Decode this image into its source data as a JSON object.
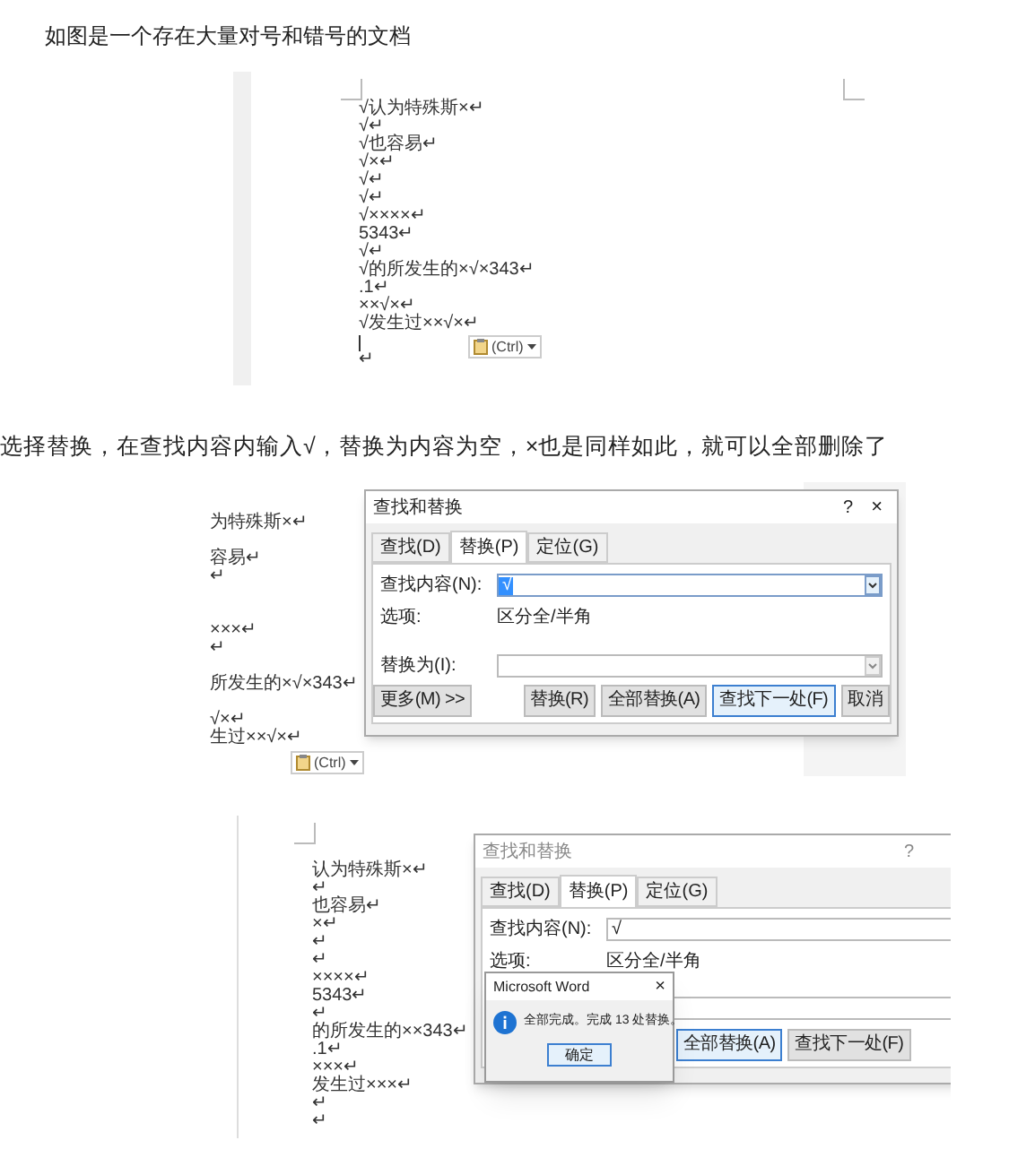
{
  "intro": "如图是一个存在大量对号和错号的文档",
  "figure_1": {
    "lines": [
      {
        "kind": "text",
        "text": "√认为特殊斯×↵"
      },
      {
        "kind": "text",
        "text": "√↵"
      },
      {
        "kind": "text",
        "text": "√也容易↵"
      },
      {
        "kind": "text",
        "text": "√×↵"
      },
      {
        "kind": "text",
        "text": "√↵"
      },
      {
        "kind": "text",
        "text": "√↵"
      },
      {
        "kind": "text",
        "text": "√××××↵"
      },
      {
        "kind": "text",
        "text": "5343↵"
      },
      {
        "kind": "text",
        "text": "√↵"
      },
      {
        "kind": "text",
        "text": "√的所发生的×√×343↵"
      },
      {
        "kind": "text",
        "text": ".1↵"
      },
      {
        "kind": "text",
        "text": "××√×↵"
      },
      {
        "kind": "text",
        "text": "√发生过××√×↵"
      },
      {
        "kind": "cursor"
      },
      {
        "kind": "text",
        "text": "↵"
      }
    ],
    "paste_button": "(Ctrl)"
  },
  "instruction": "选择替换，在查找内容内输入√，替换为内容为空，×也是同样如此，就可以全部删除了",
  "figure_2": {
    "lines": [
      {
        "kind": "text",
        "text": "为特殊斯×↵"
      },
      {
        "kind": "blank"
      },
      {
        "kind": "text",
        "text": "容易↵"
      },
      {
        "kind": "text",
        "text": "↵"
      },
      {
        "kind": "blank"
      },
      {
        "kind": "blank"
      },
      {
        "kind": "text",
        "text": "×××↵"
      },
      {
        "kind": "text",
        "text": "↵"
      },
      {
        "kind": "blank"
      },
      {
        "kind": "text",
        "text": "所发生的×√×343↵"
      },
      {
        "kind": "blank"
      },
      {
        "kind": "text",
        "text": "√×↵"
      },
      {
        "kind": "text",
        "text": "生过××√×↵"
      }
    ],
    "paste_button": "(Ctrl)",
    "dialog": {
      "title": "查找和替换",
      "help": "?",
      "close": "×",
      "tabs": [
        {
          "label": "查找(D)",
          "selected": false
        },
        {
          "label": "替换(P)",
          "selected": true
        },
        {
          "label": "定位(G)",
          "selected": false
        }
      ],
      "find_label": "查找内容(N):",
      "find_value": "√",
      "options_label": "选项:",
      "options_value": "区分全/半角",
      "replace_label": "替换为(I):",
      "buttons": [
        {
          "label": "更多(M) >>",
          "selected": false
        },
        {
          "label": "替换(R)",
          "selected": false
        },
        {
          "label": "全部替换(A)",
          "selected": false
        },
        {
          "label": "查找下一处(F)",
          "selected": true
        },
        {
          "label": "取消",
          "selected": false
        }
      ]
    }
  },
  "figure_3": {
    "lines": [
      {
        "kind": "text",
        "text": "认为特殊斯×↵"
      },
      {
        "kind": "text",
        "text": "↵"
      },
      {
        "kind": "text",
        "text": "也容易↵"
      },
      {
        "kind": "text",
        "text": "×↵"
      },
      {
        "kind": "text",
        "text": "↵"
      },
      {
        "kind": "text",
        "text": "↵"
      },
      {
        "kind": "text",
        "text": "××××↵"
      },
      {
        "kind": "text",
        "text": "5343↵"
      },
      {
        "kind": "text",
        "text": "↵"
      },
      {
        "kind": "text",
        "text": "的所发生的××343↵"
      },
      {
        "kind": "text",
        "text": ".1↵"
      },
      {
        "kind": "text",
        "text": "×××↵"
      },
      {
        "kind": "text",
        "text": "发生过×××↵"
      },
      {
        "kind": "text",
        "text": "↵"
      },
      {
        "kind": "text",
        "text": "↵"
      }
    ],
    "dialog": {
      "title": "查找和替换",
      "help": "?",
      "tabs": [
        {
          "label": "查找(D)",
          "selected": false
        },
        {
          "label": "替换(P)",
          "selected": true
        },
        {
          "label": "定位(G)",
          "selected": false
        }
      ],
      "find_label": "查找内容(N):",
      "find_value": "√",
      "options_label": "选项:",
      "options_value": "区分全/半角",
      "buttons": [
        {
          "label": "全部替换(A)",
          "selected": true
        },
        {
          "label": "查找下一处(F)",
          "selected": false
        }
      ]
    },
    "message_box": {
      "title": "Microsoft Word",
      "close": "×",
      "message": "全部完成。完成 13 处替换。",
      "ok": "确定"
    }
  }
}
